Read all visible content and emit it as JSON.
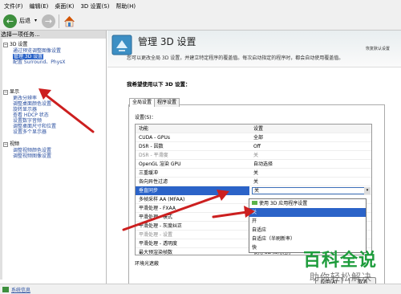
{
  "menubar": [
    "文件(F)",
    "编辑(E)",
    "桌面(K)",
    "3D 设置(S)",
    "帮助(H)"
  ],
  "toolbar": {
    "back": "后退"
  },
  "left": {
    "header": "选择一项任务...",
    "tree": [
      {
        "label": "3D 设置",
        "type": "cat"
      },
      {
        "label": "通过预览调整图像设置",
        "type": "leaf"
      },
      {
        "label": "管理 3D 设置",
        "type": "leaf",
        "selected": true
      },
      {
        "label": "配置 Surround、PhysX",
        "type": "leaf"
      },
      {
        "label": "显示",
        "type": "cat"
      },
      {
        "label": "更改分辨率",
        "type": "leaf"
      },
      {
        "label": "调整桌面颜色设置",
        "type": "leaf"
      },
      {
        "label": "旋转显示器",
        "type": "leaf"
      },
      {
        "label": "查看 HDCP 状态",
        "type": "leaf"
      },
      {
        "label": "设置数字音频",
        "type": "leaf"
      },
      {
        "label": "调整桌面尺寸和位置",
        "type": "leaf"
      },
      {
        "label": "设置多个显示器",
        "type": "leaf"
      },
      {
        "label": "视频",
        "type": "cat"
      },
      {
        "label": "调整视频颜色设置",
        "type": "leaf"
      },
      {
        "label": "调整视频图像设置",
        "type": "leaf"
      }
    ]
  },
  "status": {
    "link": "系统信息"
  },
  "main": {
    "title": "管理 3D 设置",
    "restore": "恢复默认设置",
    "description": "您可以更改全局 3D 设置，并建立特定程序的覆盖值。每次启动指定的程序时，都会自动使用覆盖值。",
    "question": "我希望使用以下 3D 设置：",
    "tabs": [
      "全局设置",
      "程序设置"
    ],
    "settings_label": "设置(S)：",
    "col_feature": "功能",
    "col_setting": "设置",
    "rows": [
      {
        "feature": "CUDA - GPUs",
        "value": "全部"
      },
      {
        "feature": "DSR - 因数",
        "value": "Off"
      },
      {
        "feature": "DSR - 平滑度",
        "value": "关",
        "dim": true
      },
      {
        "feature": "OpenGL 渲染 GPU",
        "value": "自动选择"
      },
      {
        "feature": "三重缓冲",
        "value": "关"
      },
      {
        "feature": "各向异性过滤",
        "value": "关"
      },
      {
        "feature": "垂直同步",
        "value": "关",
        "selected": true
      },
      {
        "feature": "多帧采样 AA (MFAA)",
        "value": ""
      },
      {
        "feature": "平滑处理 - FXAA",
        "value": ""
      },
      {
        "feature": "平滑处理 - 模式",
        "value": ""
      },
      {
        "feature": "平滑处理 - 灰度纠正",
        "value": ""
      },
      {
        "feature": "平滑处理 - 设置",
        "value": "",
        "dim": true
      },
      {
        "feature": "平滑处理 - 透明度",
        "value": ""
      },
      {
        "feature": "最大预渲染帧数",
        "value": "使用 3D 应用程序"
      },
      {
        "feature": "环境光遮蔽",
        "value": ""
      }
    ],
    "dropdown": [
      "使用 3D 应用程序设置",
      "关",
      "开",
      "自适应",
      "自适应（半刷新率）",
      "快"
    ],
    "dropdown_selected": 1,
    "buttons": {
      "apply": "应用(A)",
      "cancel": "取消"
    }
  },
  "watermark": {
    "title": "百科全说",
    "subtitle": "助你轻松解决"
  }
}
